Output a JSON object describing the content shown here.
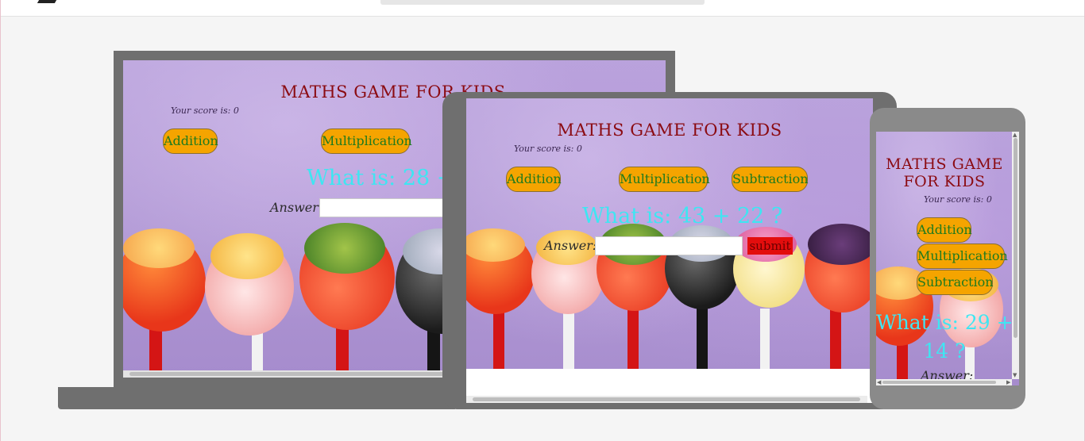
{
  "laptop": {
    "title": "MATHS GAME FOR KIDS",
    "score": "Your score is: 0",
    "buttons": [
      "Addition",
      "Multiplication"
    ],
    "question": "What is: 28 +",
    "answer_label": "Answer:"
  },
  "tablet": {
    "title": "MATHS GAME FOR KIDS",
    "score": "Your score is: 0",
    "buttons": [
      "Addition",
      "Multiplication",
      "Subtraction"
    ],
    "question": "What is: 43 + 22 ?",
    "answer_label": "Answer:",
    "submit_label": "submit"
  },
  "phone": {
    "title_line1": "MATHS GAME",
    "title_line2": "FOR KIDS",
    "score": "Your score is: 0",
    "buttons": [
      "Addition",
      "Multiplication",
      "Subtraction"
    ],
    "question_line1": "What is: 29 +",
    "question_line2": "14 ?",
    "answer_label": "Answer:"
  },
  "colors": {
    "title": "#8b0b12",
    "button_bg": "#f5a400",
    "button_text": "#1e7a1e",
    "question": "#3ee6f2",
    "submit_bg": "#e30d0d"
  }
}
